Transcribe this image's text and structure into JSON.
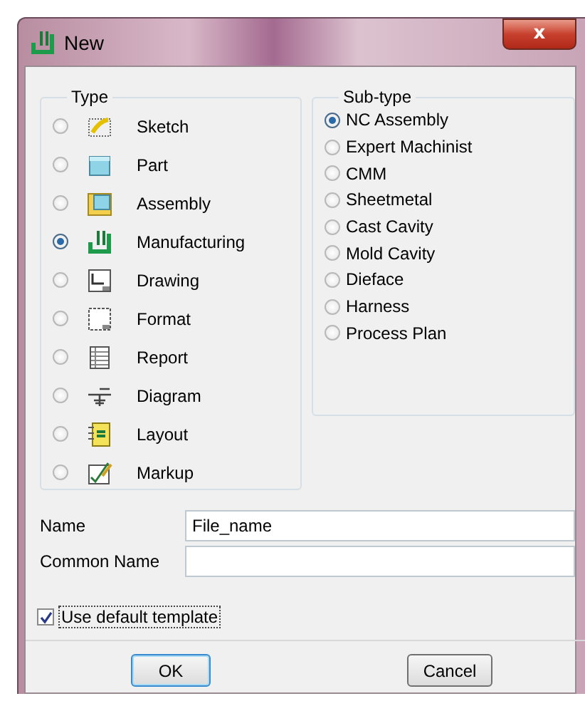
{
  "window": {
    "title": "New",
    "close": "x"
  },
  "type_group": {
    "title": "Type",
    "items": [
      {
        "label": "Sketch",
        "selected": false
      },
      {
        "label": "Part",
        "selected": false
      },
      {
        "label": "Assembly",
        "selected": false
      },
      {
        "label": "Manufacturing",
        "selected": true
      },
      {
        "label": "Drawing",
        "selected": false
      },
      {
        "label": "Format",
        "selected": false
      },
      {
        "label": "Report",
        "selected": false
      },
      {
        "label": "Diagram",
        "selected": false
      },
      {
        "label": "Layout",
        "selected": false
      },
      {
        "label": "Markup",
        "selected": false
      }
    ]
  },
  "subtype_group": {
    "title": "Sub-type",
    "items": [
      {
        "label": "NC Assembly",
        "selected": true
      },
      {
        "label": "Expert Machinist",
        "selected": false
      },
      {
        "label": "CMM",
        "selected": false
      },
      {
        "label": "Sheetmetal",
        "selected": false
      },
      {
        "label": "Cast Cavity",
        "selected": false
      },
      {
        "label": "Mold Cavity",
        "selected": false
      },
      {
        "label": "Dieface",
        "selected": false
      },
      {
        "label": "Harness",
        "selected": false
      },
      {
        "label": "Process Plan",
        "selected": false
      }
    ]
  },
  "fields": [
    {
      "label": "Name",
      "value": "File_name"
    },
    {
      "label": "Common Name"
    }
  ],
  "use_default_template": {
    "label": "Use default template",
    "checked": true
  },
  "buttons": [
    {
      "label": "OK",
      "default": true
    },
    {
      "label": "Cancel",
      "default": false
    }
  ]
}
